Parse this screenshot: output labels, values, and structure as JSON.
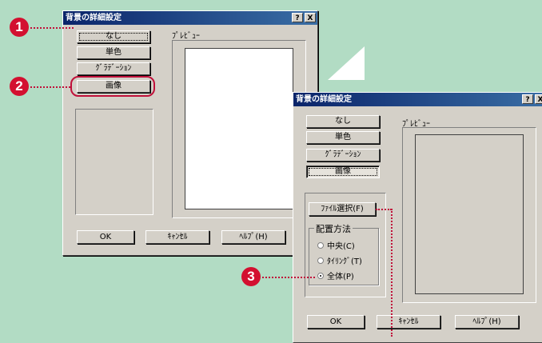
{
  "dialog1": {
    "title": "背景の詳細設定",
    "help_btn": "?",
    "close_btn": "X",
    "modes": [
      "なし",
      "単色",
      "ｸﾞﾗﾃﾞｰｼｮﾝ",
      "画像"
    ],
    "preview_label": "ﾌﾟﾚﾋﾞｭｰ",
    "ok": "OK",
    "cancel": "ｷｬﾝｾﾙ",
    "help": "ﾍﾙﾌﾟ(H)"
  },
  "dialog2": {
    "title": "背景の詳細設定",
    "help_btn": "?",
    "close_btn": "X",
    "modes": [
      "なし",
      "単色",
      "ｸﾞﾗﾃﾞｰｼｮﾝ",
      "画像"
    ],
    "preview_label": "ﾌﾟﾚﾋﾞｭｰ",
    "file_select": "ﾌｧｲﾙ選択(F)",
    "placement_label": "配置方法",
    "options": [
      "中央(C)",
      "ﾀｲﾘﾝｸﾞ(T)",
      "全体(P)"
    ],
    "selected_option": "全体(P)",
    "ok": "OK",
    "cancel": "ｷｬﾝｾﾙ",
    "help": "ﾍﾙﾌﾟ(H)"
  },
  "callouts": [
    "1",
    "2",
    "3"
  ],
  "colors": {
    "callout": "#d31030",
    "background": "#b2dcc4",
    "titlebar": "#0a246a"
  }
}
